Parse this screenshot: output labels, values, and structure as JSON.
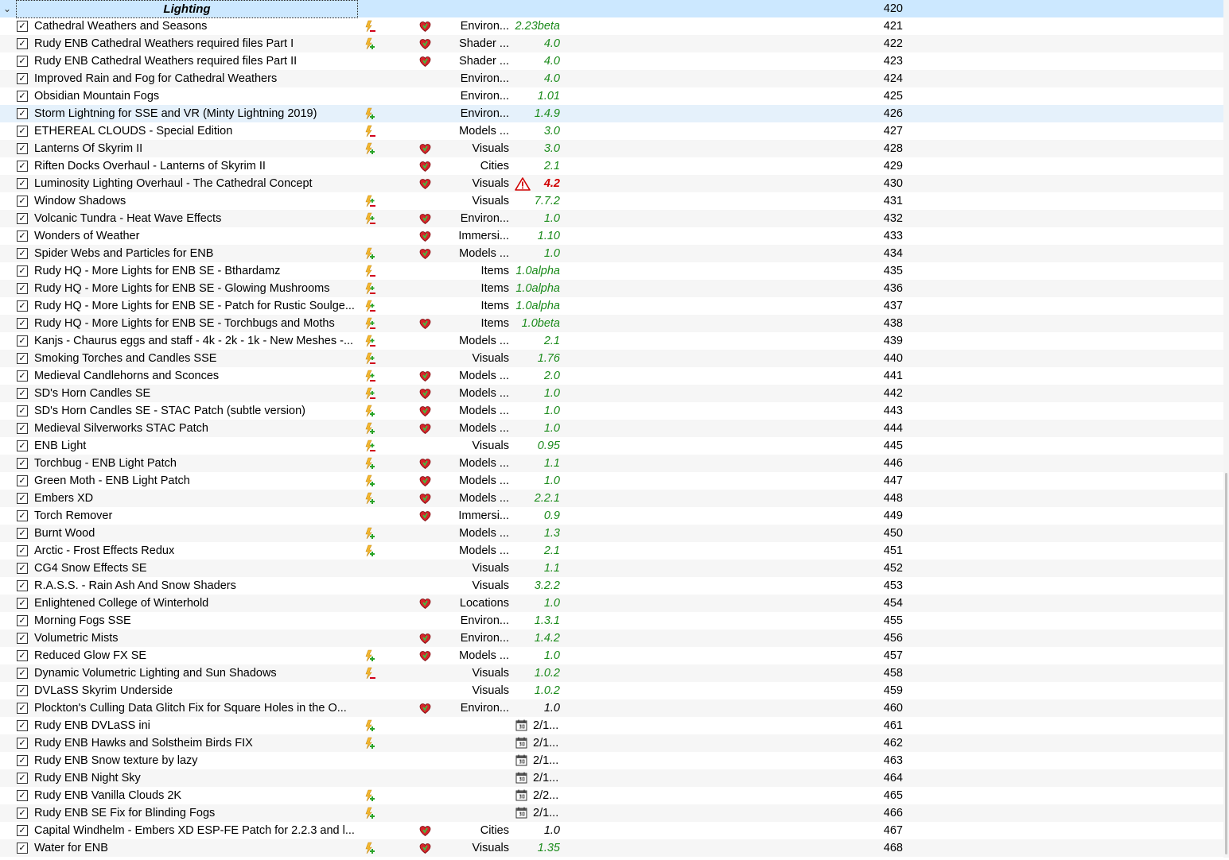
{
  "separator": {
    "title": "Lighting",
    "priority": "420"
  },
  "mods": [
    {
      "name": "Cathedral Weathers and Seasons",
      "flag": "red",
      "heart": true,
      "category": "Environ...",
      "version": "2.23beta",
      "priority": "421"
    },
    {
      "name": "Rudy ENB Cathedral Weathers required files Part I",
      "flag": "green",
      "heart": true,
      "category": "Shader ...",
      "version": "4.0",
      "priority": "422"
    },
    {
      "name": "Rudy ENB Cathedral Weathers required files Part II",
      "flag": "",
      "heart": true,
      "category": "Shader ...",
      "version": "4.0",
      "priority": "423"
    },
    {
      "name": "Improved Rain and Fog for Cathedral Weathers",
      "flag": "",
      "heart": false,
      "category": "Environ...",
      "version": "4.0",
      "priority": "424"
    },
    {
      "name": "Obsidian Mountain Fogs",
      "flag": "",
      "heart": false,
      "category": "Environ...",
      "version": "1.01",
      "priority": "425"
    },
    {
      "name": "Storm Lightning for SSE and VR (Minty Lightning 2019)",
      "flag": "green",
      "heart": false,
      "category": "Environ...",
      "version": "1.4.9",
      "priority": "426",
      "selected": true
    },
    {
      "name": "ETHEREAL CLOUDS - Special Edition",
      "flag": "red",
      "heart": false,
      "category": "Models ...",
      "version": "3.0",
      "priority": "427"
    },
    {
      "name": "Lanterns Of Skyrim II",
      "flag": "green",
      "heart": true,
      "category": "Visuals",
      "version": "3.0",
      "priority": "428"
    },
    {
      "name": "Riften Docks Overhaul - Lanterns of Skyrim II",
      "flag": "",
      "heart": true,
      "category": "Cities",
      "version": "2.1",
      "priority": "429"
    },
    {
      "name": "Luminosity Lighting Overhaul - The Cathedral Concept",
      "flag": "",
      "heart": true,
      "category": "Visuals",
      "version": "4.2",
      "priority": "430",
      "warning": true
    },
    {
      "name": "Window Shadows",
      "flag": "greenred",
      "heart": false,
      "category": "Visuals",
      "version": "7.7.2",
      "priority": "431"
    },
    {
      "name": "Volcanic Tundra - Heat Wave Effects",
      "flag": "greenred",
      "heart": true,
      "category": "Environ...",
      "version": "1.0",
      "priority": "432"
    },
    {
      "name": "Wonders of Weather",
      "flag": "",
      "heart": true,
      "category": "Immersi...",
      "version": "1.10",
      "priority": "433"
    },
    {
      "name": "Spider Webs and Particles for ENB",
      "flag": "green",
      "heart": true,
      "category": "Models ...",
      "version": "1.0",
      "priority": "434"
    },
    {
      "name": "Rudy HQ - More Lights for ENB SE - Bthardamz",
      "flag": "red",
      "heart": false,
      "category": "Items",
      "version": "1.0alpha",
      "priority": "435"
    },
    {
      "name": "Rudy HQ - More Lights for ENB SE - Glowing Mushrooms",
      "flag": "greenred",
      "heart": false,
      "category": "Items",
      "version": "1.0alpha",
      "priority": "436"
    },
    {
      "name": "Rudy HQ - More Lights for ENB SE - Patch for Rustic Soulge...",
      "flag": "greenred",
      "heart": false,
      "category": "Items",
      "version": "1.0alpha",
      "priority": "437"
    },
    {
      "name": "Rudy HQ - More Lights for ENB SE - Torchbugs and Moths",
      "flag": "greenred",
      "heart": true,
      "category": "Items",
      "version": "1.0beta",
      "priority": "438"
    },
    {
      "name": "Kanjs - Chaurus eggs and staff - 4k - 2k - 1k - New Meshes -...",
      "flag": "greenred",
      "heart": false,
      "category": "Models ...",
      "version": "2.1",
      "priority": "439"
    },
    {
      "name": "Smoking Torches and Candles SSE",
      "flag": "greenred",
      "heart": false,
      "category": "Visuals",
      "version": "1.76",
      "priority": "440"
    },
    {
      "name": "Medieval Candlehorns and Sconces",
      "flag": "greenred",
      "heart": true,
      "category": "Models ...",
      "version": "2.0",
      "priority": "441"
    },
    {
      "name": "SD's Horn Candles SE",
      "flag": "greenred",
      "heart": true,
      "category": "Models ...",
      "version": "1.0",
      "priority": "442"
    },
    {
      "name": "SD's Horn Candles SE - STAC Patch (subtle version)",
      "flag": "green",
      "heart": true,
      "category": "Models ...",
      "version": "1.0",
      "priority": "443"
    },
    {
      "name": "Medieval Silverworks STAC Patch",
      "flag": "green",
      "heart": true,
      "category": "Models ...",
      "version": "1.0",
      "priority": "444"
    },
    {
      "name": "ENB Light",
      "flag": "greenred",
      "heart": false,
      "category": "Visuals",
      "version": "0.95",
      "priority": "445"
    },
    {
      "name": "Torchbug - ENB Light Patch",
      "flag": "green",
      "heart": true,
      "category": "Models ...",
      "version": "1.1",
      "priority": "446"
    },
    {
      "name": "Green Moth - ENB Light Patch",
      "flag": "green",
      "heart": true,
      "category": "Models ...",
      "version": "1.0",
      "priority": "447"
    },
    {
      "name": "Embers XD",
      "flag": "green",
      "heart": true,
      "category": "Models ...",
      "version": "2.2.1",
      "priority": "448"
    },
    {
      "name": "Torch Remover",
      "flag": "",
      "heart": true,
      "category": "Immersi...",
      "version": "0.9",
      "priority": "449"
    },
    {
      "name": "Burnt Wood",
      "flag": "green",
      "heart": false,
      "category": "Models ...",
      "version": "1.3",
      "priority": "450"
    },
    {
      "name": "Arctic - Frost Effects Redux",
      "flag": "green",
      "heart": false,
      "category": "Models ...",
      "version": "2.1",
      "priority": "451"
    },
    {
      "name": "CG4 Snow Effects SE",
      "flag": "",
      "heart": false,
      "category": "Visuals",
      "version": "1.1",
      "priority": "452"
    },
    {
      "name": "R.A.S.S. - Rain Ash And Snow Shaders",
      "flag": "",
      "heart": false,
      "category": "Visuals",
      "version": "3.2.2",
      "priority": "453"
    },
    {
      "name": "Enlightened College of Winterhold",
      "flag": "",
      "heart": true,
      "category": "Locations",
      "version": "1.0",
      "priority": "454"
    },
    {
      "name": "Morning Fogs SSE",
      "flag": "",
      "heart": false,
      "category": "Environ...",
      "version": "1.3.1",
      "priority": "455"
    },
    {
      "name": "Volumetric Mists",
      "flag": "",
      "heart": true,
      "category": "Environ...",
      "version": "1.4.2",
      "priority": "456"
    },
    {
      "name": "Reduced Glow FX SE",
      "flag": "green",
      "heart": true,
      "category": "Models ...",
      "version": "1.0",
      "priority": "457"
    },
    {
      "name": "Dynamic Volumetric Lighting and Sun Shadows",
      "flag": "red",
      "heart": false,
      "category": "Visuals",
      "version": "1.0.2",
      "priority": "458"
    },
    {
      "name": "DVLaSS Skyrim Underside",
      "flag": "",
      "heart": false,
      "category": "Visuals",
      "version": "1.0.2",
      "priority": "459"
    },
    {
      "name": "Plockton's Culling Data Glitch Fix for Square Holes in the O...",
      "flag": "",
      "heart": true,
      "category": "Environ...",
      "version": "1.0",
      "priority": "460",
      "versionPlain": true
    },
    {
      "name": "Rudy ENB DVLaSS ini",
      "flag": "green",
      "heart": false,
      "category": "",
      "date": "2/1...",
      "priority": "461"
    },
    {
      "name": "Rudy ENB Hawks and Solstheim Birds FIX",
      "flag": "green",
      "heart": false,
      "category": "",
      "date": "2/1...",
      "priority": "462"
    },
    {
      "name": "Rudy ENB Snow texture by lazy",
      "flag": "",
      "heart": false,
      "category": "",
      "date": "2/1...",
      "priority": "463"
    },
    {
      "name": "Rudy ENB Night Sky",
      "flag": "",
      "heart": false,
      "category": "",
      "date": "2/1...",
      "priority": "464"
    },
    {
      "name": "Rudy ENB Vanilla Clouds 2K",
      "flag": "green",
      "heart": false,
      "category": "",
      "date": "2/2...",
      "priority": "465"
    },
    {
      "name": "Rudy ENB SE Fix for Blinding Fogs",
      "flag": "green",
      "heart": false,
      "category": "",
      "date": "2/1...",
      "priority": "466"
    },
    {
      "name": "Capital Windhelm - Embers XD ESP-FE Patch for 2.2.3 and l...",
      "flag": "",
      "heart": true,
      "category": "Cities",
      "version": "1.0",
      "priority": "467",
      "versionPlain": true
    },
    {
      "name": "Water for ENB",
      "flag": "green",
      "heart": true,
      "category": "Visuals",
      "version": "1.35",
      "priority": "468"
    }
  ],
  "colors": {
    "version_ok": "#1a8a1a",
    "version_warn": "#d00000",
    "separator_bg": "#cce8ff",
    "selected_bg": "#e5f1fb"
  }
}
